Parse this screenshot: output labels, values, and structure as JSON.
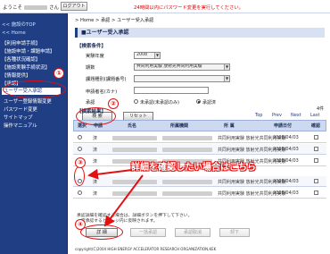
{
  "header": {
    "greeting_suffix": "さん",
    "logout_label": "ログアウト",
    "notice": "24時間以内にパスワード変更を実行してください。"
  },
  "sidebar": {
    "top": "<< 施設のTOP",
    "home": "<< Home",
    "items": [
      "【利用申請手続】",
      "【施設申請・課題申請】",
      "【各種状況確認】",
      "【施設実験手続状況】",
      "【情報提供】",
      "【承認】",
      "ユーザー受入承認",
      "ユーザー登録情報変更",
      "パスワード変更",
      "サイトマップ",
      "操作マニュアル"
    ]
  },
  "breadcrumb": "> Home > 承認 > ユーザー受入承認",
  "page_title": "■ユーザー受入承認",
  "search": {
    "section_label": "【検索条件】",
    "fields": [
      {
        "label": "実験年度",
        "value": "2008"
      },
      {
        "label": "期数",
        "value": "共同利用実験 放射光共同利用実験"
      },
      {
        "label": "課題種別(課題番号)",
        "value": ""
      },
      {
        "label": "申請者名(カナ)",
        "value": ""
      },
      {
        "label": "承認",
        "value": ""
      }
    ],
    "radio_unapproved": "未承認(未承認のみ)",
    "radio_approved": "承認済",
    "search_button": "検 索",
    "reset_button": "リセット"
  },
  "results": {
    "section_label": "【検索結果】",
    "count": "4件",
    "paging": [
      "Top",
      "Prev",
      "Next",
      "Last"
    ],
    "columns": [
      "選択",
      "申請",
      "氏名",
      "所属機関",
      "所 属",
      "申請日付",
      "確認"
    ],
    "rows": [
      {
        "apply": "済",
        "status": "共同利用実験 放射光共同利用実験",
        "date": "2008/04/03"
      },
      {
        "apply": "済",
        "status": "共同利用実験 放射光共同利用実験",
        "date": "2008/04/03"
      },
      {
        "apply": "済",
        "status": "共同利用実験 放射光共同利用実験",
        "date": "2008/04/03"
      },
      {
        "apply": "済",
        "status": "共同利用実験 放射光共同利用実験",
        "date": "2008/04/03"
      },
      {
        "apply": "済",
        "status": "共同利用実験 放射光共同利用実験",
        "date": "2008/04/03"
      }
    ]
  },
  "footnote": "承認詳細を確認する場合は、詳細ボタンを押下して下さい。\n一度承認するとページ内に反映されます。",
  "buttons": {
    "detail": "詳 細",
    "approve": "一括承認",
    "cancel": "承認取消",
    "reject": "却下"
  },
  "annotation": {
    "callout": "詳細を確認したい場合はこちら",
    "n1": "①",
    "n2": "②",
    "n3": "③",
    "n4": "④",
    "color": "#e21010"
  },
  "copyright": "copyright(C)2004 HIGH ENERGY ACCELERATOR RESEARCH ORGANIZATION,KEK"
}
